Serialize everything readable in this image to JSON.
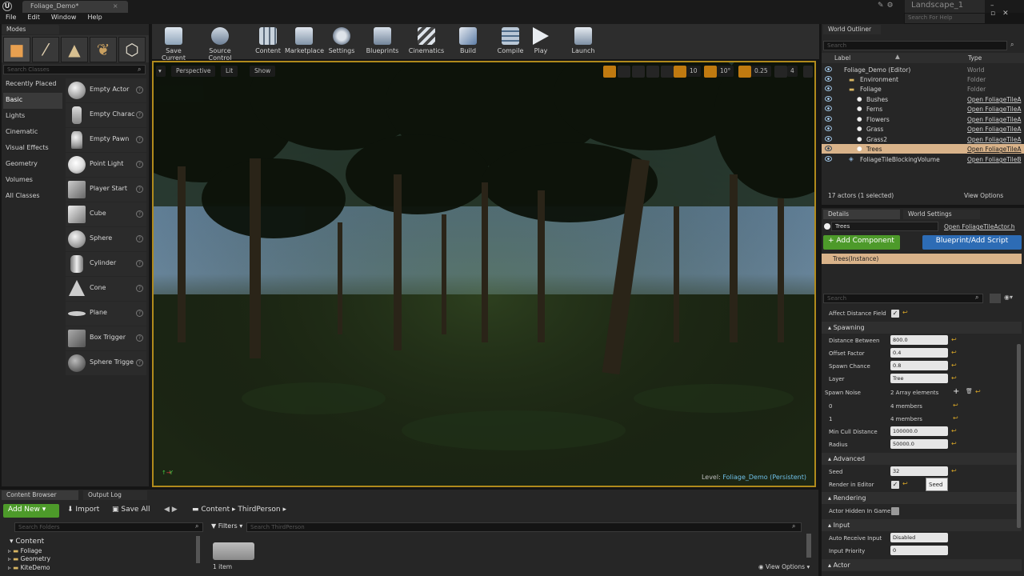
{
  "window": {
    "doc_tab": "Foliage_Demo*",
    "project": "Landscape_1",
    "help_placeholder": "Search For Help"
  },
  "menu": [
    "File",
    "Edit",
    "Window",
    "Help"
  ],
  "modes": {
    "title": "Modes",
    "search_placeholder": "Search Classes",
    "categories": [
      "Recently Placed",
      "Basic",
      "Lights",
      "Cinematic",
      "Visual Effects",
      "Geometry",
      "Volumes",
      "All Classes"
    ],
    "items": [
      "Empty Actor",
      "Empty Charac",
      "Empty Pawn",
      "Point Light",
      "Player Start",
      "Cube",
      "Sphere",
      "Cylinder",
      "Cone",
      "Plane",
      "Box Trigger",
      "Sphere Trigge"
    ]
  },
  "toolbar": [
    "Save Current",
    "Source Control",
    "Content",
    "Marketplace",
    "Settings",
    "Blueprints",
    "Cinematics",
    "Build",
    "Compile",
    "Play",
    "Launch"
  ],
  "viewport": {
    "perspective": "Perspective",
    "lit": "Lit",
    "show": "Show",
    "grid": "10",
    "angle": "10°",
    "scale": "0.25",
    "speed": "4",
    "level_prefix": "Level:",
    "level_name": "Foliage_Demo (Persistent)"
  },
  "outliner": {
    "title": "World Outliner",
    "search_placeholder": "Search",
    "col_label": "Label",
    "col_type": "Type",
    "rows": [
      {
        "label": "Foliage_Demo (Editor)",
        "type": "World"
      },
      {
        "label": "Environment",
        "type": "Folder"
      },
      {
        "label": "Foliage",
        "type": "Folder"
      },
      {
        "label": "Bushes",
        "type": "Open FoliageTileA"
      },
      {
        "label": "Ferns",
        "type": "Open FoliageTileA"
      },
      {
        "label": "Flowers",
        "type": "Open FoliageTileA"
      },
      {
        "label": "Grass",
        "type": "Open FoliageTileA"
      },
      {
        "label": "Grass2",
        "type": "Open FoliageTileA"
      },
      {
        "label": "Trees",
        "type": "Open FoliageTileA"
      },
      {
        "label": "FoliageTileBlockingVolume",
        "type": "Open FoliageTileB"
      }
    ],
    "footer": "17 actors (1 selected)",
    "view_options": "View Options"
  },
  "details": {
    "tab_details": "Details",
    "tab_world": "World Settings",
    "name": "Trees",
    "open_link": "Open FoliageTileActor.h",
    "add_component": "+ Add Component",
    "blueprint_btn": "Blueprint/Add Script",
    "component": "Trees(Instance)",
    "search_placeholder": "Search",
    "affect_distance_field": "Affect Distance Field",
    "spawning": "Spawning",
    "distance_between": {
      "label": "Distance Between",
      "value": "800.0"
    },
    "offset_factor": {
      "label": "Offset Factor",
      "value": "0.4"
    },
    "spawn_chance": {
      "label": "Spawn Chance",
      "value": "0.8"
    },
    "layer": {
      "label": "Layer",
      "value": "Tree"
    },
    "spawn_noise": {
      "label": "Spawn Noise",
      "value": "2 Array elements"
    },
    "noise0": {
      "label": "0",
      "value": "4 members"
    },
    "noise1": {
      "label": "1",
      "value": "4 members"
    },
    "min_cull": {
      "label": "Min Cull Distance",
      "value": "100000.0"
    },
    "radius": {
      "label": "Radius",
      "value": "50000.0"
    },
    "advanced": "Advanced",
    "seed": {
      "label": "Seed",
      "value": "32"
    },
    "seed_tooltip": "Seed",
    "render_in_editor": "Render in Editor",
    "rendering": "Rendering",
    "actor_hidden": "Actor Hidden In Game",
    "input": "Input",
    "auto_receive": {
      "label": "Auto Receive Input",
      "value": "Disabled"
    },
    "input_priority": {
      "label": "Input Priority",
      "value": "0"
    },
    "actor": "Actor"
  },
  "content_browser": {
    "tab": "Content Browser",
    "tab_log": "Output Log",
    "add_new": "Add New",
    "import": "Import",
    "save_all": "Save All",
    "path_root": "Content",
    "path_sub": "ThirdPerson",
    "search_folders": "Search Folders",
    "filters": "Filters",
    "search_assets": "Search ThirdPerson",
    "tree": [
      "Content",
      "Foliage",
      "Geometry",
      "KiteDemo"
    ],
    "item_count": "1 item",
    "view_options": "View Options"
  }
}
